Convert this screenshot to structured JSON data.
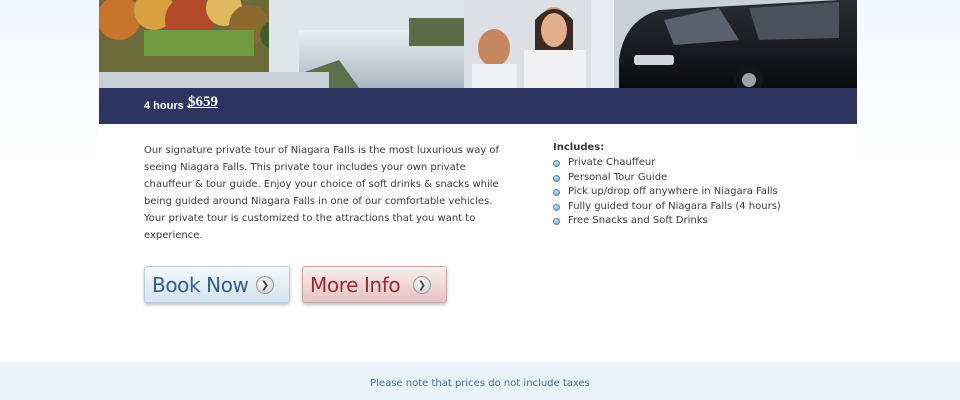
{
  "tour": {
    "duration": "4 hours -",
    "price": "$659"
  },
  "description": "Our signature private tour of Niagara Falls is the most luxurious way of seeing Niagara Falls. This private tour includes your own private chauffeur & tour guide. Enjoy your choice of soft drinks & snacks while being guided around Niagara Falls in one of our comfortable vehicles. Your private tour is customized to the attractions that you want to experience.",
  "includes": {
    "heading": "Includes:",
    "items": [
      "Private Chauffeur",
      "Personal Tour Guide",
      "Pick up/drop off anywhere in Niagara Falls",
      "Fully guided tour of Niagara Falls (4 hours)",
      "Free Snacks and Soft Drinks"
    ]
  },
  "buttons": {
    "book": "Book Now",
    "info": "More Info"
  },
  "footer": {
    "note": "Please note that prices do not include taxes"
  },
  "colors": {
    "price_bar": "#2b3560",
    "book_text": "#2e5f93",
    "info_text": "#9c2a2e",
    "footer_text": "#3c6fa8"
  },
  "hero": {
    "icon": "hero-photo-niagara-falls-family-van"
  }
}
